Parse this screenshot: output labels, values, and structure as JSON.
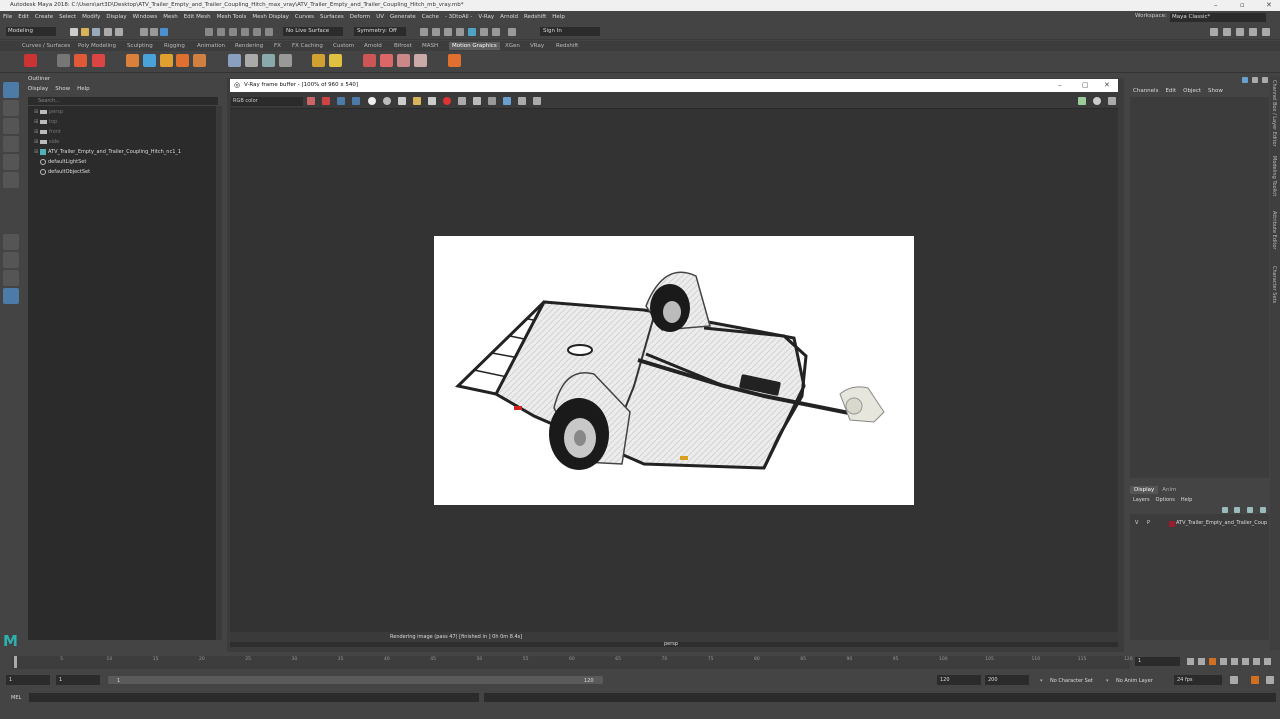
{
  "window": {
    "title": "Autodesk Maya 2018: C:\\Users\\art3D\\Desktop\\ATV_Trailer_Empty_and_Trailer_Coupling_Hitch_max_vray\\ATV_Trailer_Empty_and_Trailer_Coupling_Hitch_mb_vray.mb*"
  },
  "menubar": [
    "File",
    "Edit",
    "Create",
    "Select",
    "Modify",
    "Display",
    "Windows",
    "Mesh",
    "Edit Mesh",
    "Mesh Tools",
    "Mesh Display",
    "Curves",
    "Surfaces",
    "Deform",
    "UV",
    "Generate",
    "Cache",
    "- 3DtoAll -",
    "V-Ray",
    "Arnold",
    "Redshift",
    "Help"
  ],
  "workspace": {
    "label": "Workspace:",
    "value": "Maya Classic*"
  },
  "statusline": {
    "mode": "Modeling",
    "live_surface": "No Live Surface",
    "symmetry": "Symmetry: Off",
    "sign_in": "Sign In"
  },
  "shelf_tabs": [
    "Curves / Surfaces",
    "Poly Modeling",
    "Sculpting",
    "Rigging",
    "Animation",
    "Rendering",
    "FX",
    "FX Caching",
    "Custom",
    "Arnold",
    "Bifrost",
    "MASH",
    "Motion Graphics",
    "XGen",
    "VRay",
    "Redshift"
  ],
  "shelf_active": "Motion Graphics",
  "outliner": {
    "title": "Outliner",
    "menu": [
      "Display",
      "Show",
      "Help"
    ],
    "search_placeholder": "Search...",
    "items": [
      {
        "label": "persp",
        "dim": true
      },
      {
        "label": "top",
        "dim": true
      },
      {
        "label": "front",
        "dim": true
      },
      {
        "label": "side",
        "dim": true
      },
      {
        "label": "ATV_Trailer_Empty_and_Trailer_Coupling_Hitch_nc1_1",
        "dim": false
      },
      {
        "label": "defaultLightSet",
        "dim": false
      },
      {
        "label": "defaultObjectSet",
        "dim": false
      }
    ]
  },
  "vfb": {
    "title": "V-Ray frame buffer - [100% of 960 x 540]",
    "channel": "RGB color",
    "status": "Rendering image (pass 47) [finished in ] 0h  0m  8.4s]"
  },
  "viewport_label": "persp",
  "channelbox": {
    "menu": [
      "Channels",
      "Edit",
      "Object",
      "Show"
    ]
  },
  "layer_editor": {
    "tabs": [
      "Display",
      "Anim"
    ],
    "menu": [
      "Layers",
      "Options",
      "Help"
    ],
    "layer": {
      "v": "V",
      "p": "P",
      "name": "ATV_Trailer_Empty_and_Trailer_Coup",
      "color": "#9b1b30"
    }
  },
  "side_tabs": [
    "Channel Box / Layer Editor",
    "Modeling Toolkit",
    "Attribute Editor",
    "Character Sets"
  ],
  "timeline": {
    "ticks": [
      "1",
      "5",
      "10",
      "15",
      "20",
      "25",
      "30",
      "35",
      "40",
      "45",
      "50",
      "55",
      "60",
      "65",
      "70",
      "75",
      "80",
      "85",
      "90",
      "95",
      "100",
      "105",
      "110",
      "115",
      "120"
    ],
    "current_frame": "1"
  },
  "range": {
    "start": "1",
    "inner_start": "1",
    "slider_start": "1",
    "slider_end": "120",
    "end": "120",
    "outer_end": "200",
    "character_set": "No Character Set",
    "anim_layer": "No Anim Layer",
    "fps": "24 fps"
  },
  "mel": {
    "label": "MEL"
  }
}
